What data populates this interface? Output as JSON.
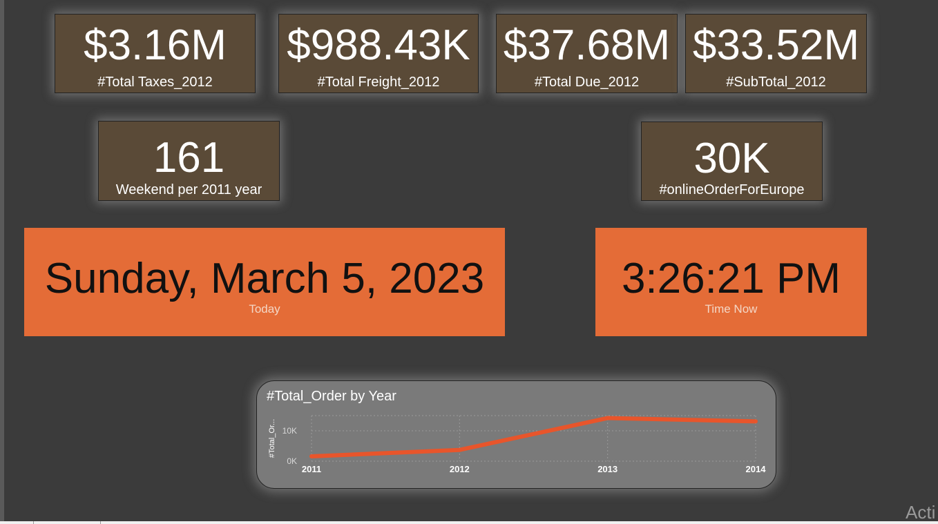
{
  "kpis": [
    {
      "value": "$3.16M",
      "label": "#Total Taxes_2012"
    },
    {
      "value": "$988.43K",
      "label": "#Total Freight_2012"
    },
    {
      "value": "$37.68M",
      "label": "#Total Due_2012"
    },
    {
      "value": "$33.52M",
      "label": "#SubTotal_2012"
    },
    {
      "value": "161",
      "label": "Weekend per 2011 year"
    },
    {
      "value": "30K",
      "label": "#onlineOrderForEurope"
    }
  ],
  "today": {
    "value": "Sunday, March 5, 2023",
    "label": "Today"
  },
  "time_now": {
    "value": "3:26:21 PM",
    "label": "Time Now"
  },
  "chart_data": {
    "type": "line",
    "title": "#Total_Order by Year",
    "ylabel": "#Total_Or...",
    "xlabel": "",
    "categories": [
      "2011",
      "2012",
      "2013",
      "2014"
    ],
    "series": [
      {
        "values": [
          1600,
          3700,
          14200,
          13100
        ]
      }
    ],
    "yticks": [
      "0K",
      "10K"
    ],
    "ylim": [
      0,
      15000
    ],
    "grid": true,
    "line_color": "#e8552b"
  },
  "watermark": "Acti"
}
